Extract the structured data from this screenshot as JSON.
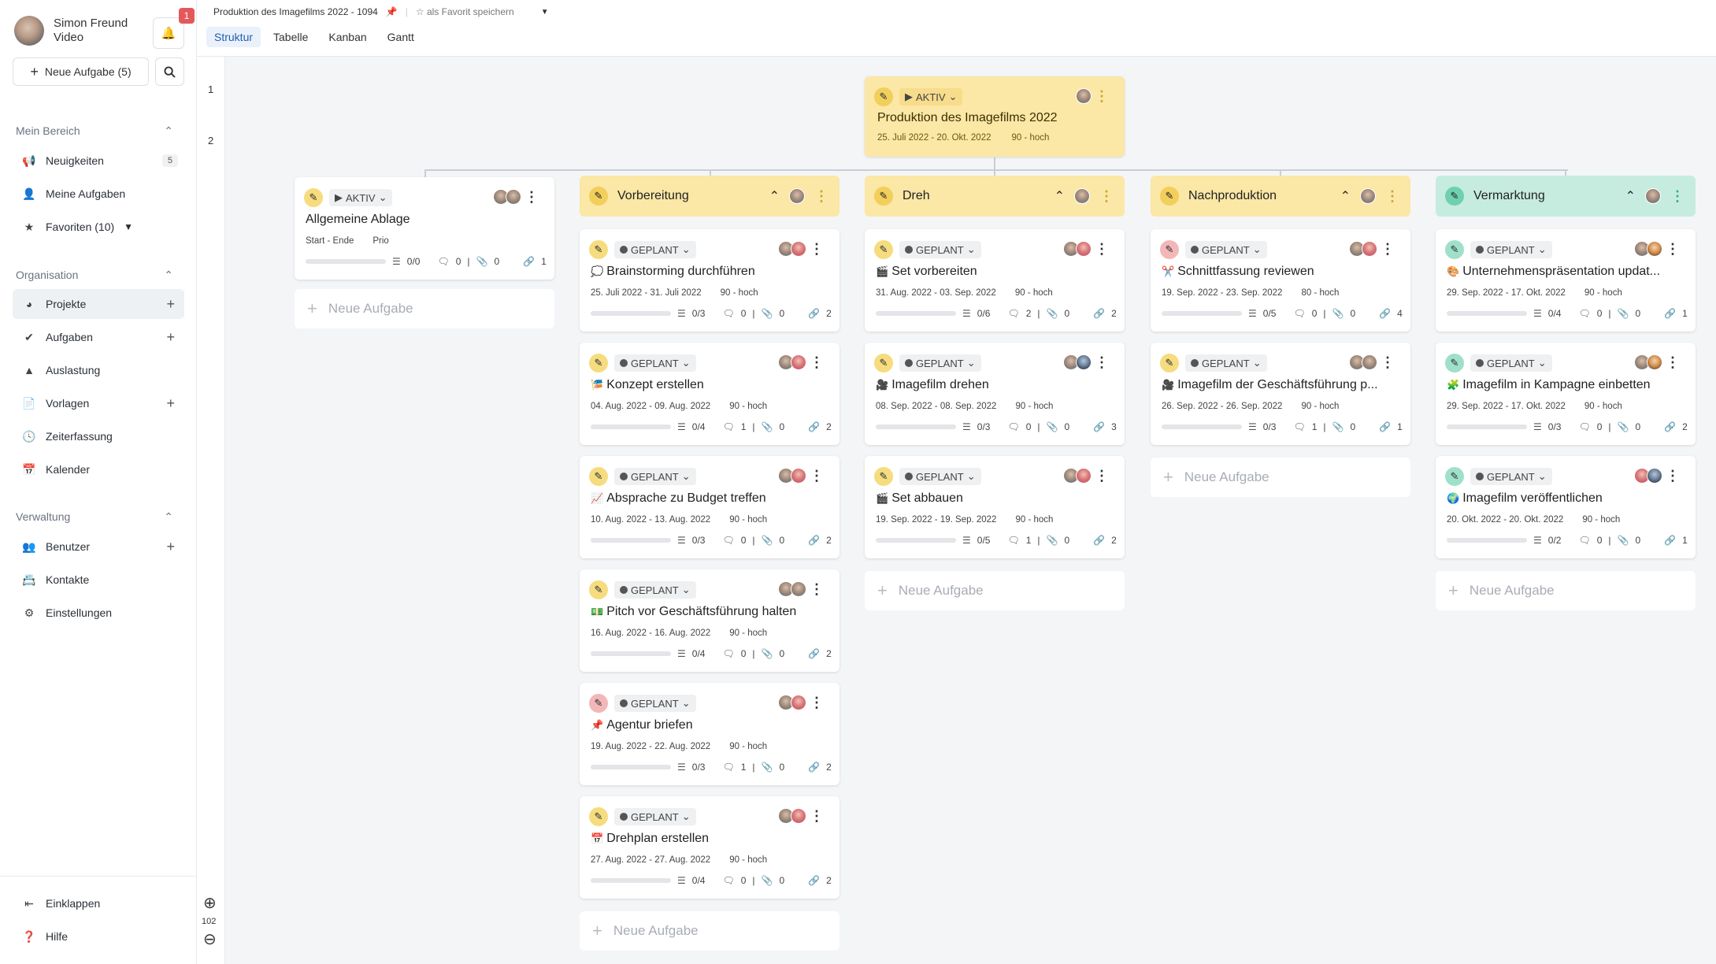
{
  "user": {
    "name": "Simon Freund",
    "role": "Video",
    "notifications": "1"
  },
  "sidebar": {
    "new_task_label": "Neue Aufgabe (5)",
    "mein_bereich": "Mein Bereich",
    "neuigkeiten": "Neuigkeiten",
    "neuigkeiten_count": "5",
    "meine_aufgaben": "Meine Aufgaben",
    "favoriten": "Favoriten (10)",
    "organisation": "Organisation",
    "projekte": "Projekte",
    "aufgaben": "Aufgaben",
    "auslastung": "Auslastung",
    "vorlagen": "Vorlagen",
    "zeiterfassung": "Zeiterfassung",
    "kalender": "Kalender",
    "verwaltung": "Verwaltung",
    "benutzer": "Benutzer",
    "kontakte": "Kontakte",
    "einstellungen": "Einstellungen",
    "einklappen": "Einklappen",
    "hilfe": "Hilfe"
  },
  "header": {
    "breadcrumb": "Produktion des Imagefilms 2022 - 1094",
    "favorite": "als Favorit speichern",
    "tabs": [
      "Struktur",
      "Tabelle",
      "Kanban",
      "Gantt"
    ]
  },
  "ruler": {
    "level1": "1",
    "level2": "2",
    "zoom": "102"
  },
  "root": {
    "status": "AKTIV",
    "title": "Produktion des Imagefilms 2022",
    "dates": "25. Juli 2022 - 20. Okt. 2022",
    "prio": "90 - hoch"
  },
  "ablage": {
    "status": "AKTIV",
    "title": "Allgemeine Ablage",
    "dates": "Start - Ende",
    "prio": "Prio",
    "checks": "0/0",
    "comments": "0",
    "attach": "0",
    "links": "1"
  },
  "new_task": "Neue Aufgabe",
  "columns": [
    {
      "title": "Vorbereitung",
      "tasks": [
        {
          "status": "GEPLANT",
          "emoji": "💭",
          "title": "Brainstorming durchführen",
          "dates": "25. Juli 2022 - 31. Juli 2022",
          "prio": "90 - hoch",
          "checks": "0/3",
          "comments": "0",
          "attach": "0",
          "links": "2"
        },
        {
          "status": "GEPLANT",
          "emoji": "🎏",
          "title": "Konzept erstellen",
          "dates": "04. Aug. 2022 - 09. Aug. 2022",
          "prio": "90 - hoch",
          "checks": "0/4",
          "comments": "1",
          "attach": "0",
          "links": "2"
        },
        {
          "status": "GEPLANT",
          "emoji": "📈",
          "title": "Absprache zu Budget treffen",
          "dates": "10. Aug. 2022 - 13. Aug. 2022",
          "prio": "90 - hoch",
          "checks": "0/3",
          "comments": "0",
          "attach": "0",
          "links": "2"
        },
        {
          "status": "GEPLANT",
          "emoji": "💵",
          "title": "Pitch vor Geschäftsführung halten",
          "dates": "16. Aug. 2022 - 16. Aug. 2022",
          "prio": "90 - hoch",
          "checks": "0/4",
          "comments": "0",
          "attach": "0",
          "links": "2"
        },
        {
          "status": "GEPLANT",
          "emoji": "📌",
          "title": "Agentur briefen",
          "dates": "19. Aug. 2022 - 22. Aug. 2022",
          "prio": "90 - hoch",
          "checks": "0/3",
          "comments": "1",
          "attach": "0",
          "links": "2"
        },
        {
          "status": "GEPLANT",
          "emoji": "📅",
          "title": "Drehplan erstellen",
          "dates": "27. Aug. 2022 - 27. Aug. 2022",
          "prio": "90 - hoch",
          "checks": "0/4",
          "comments": "0",
          "attach": "0",
          "links": "2"
        }
      ]
    },
    {
      "title": "Dreh",
      "tasks": [
        {
          "status": "GEPLANT",
          "emoji": "🎬",
          "title": "Set vorbereiten",
          "dates": "31. Aug. 2022 - 03. Sep. 2022",
          "prio": "90 - hoch",
          "checks": "0/6",
          "comments": "2",
          "attach": "0",
          "links": "2"
        },
        {
          "status": "GEPLANT",
          "emoji": "🎥",
          "title": "Imagefilm drehen",
          "dates": "08. Sep. 2022 - 08. Sep. 2022",
          "prio": "90 - hoch",
          "checks": "0/3",
          "comments": "0",
          "attach": "0",
          "links": "3"
        },
        {
          "status": "GEPLANT",
          "emoji": "🎬",
          "title": "Set abbauen",
          "dates": "19. Sep. 2022 - 19. Sep. 2022",
          "prio": "90 - hoch",
          "checks": "0/5",
          "comments": "1",
          "attach": "0",
          "links": "2"
        }
      ]
    },
    {
      "title": "Nachproduktion",
      "tasks": [
        {
          "status": "GEPLANT",
          "emoji": "✂️",
          "title": "Schnittfassung reviewen",
          "dates": "19. Sep. 2022 - 23. Sep. 2022",
          "prio": "80 - hoch",
          "checks": "0/5",
          "comments": "0",
          "attach": "0",
          "links": "4"
        },
        {
          "status": "GEPLANT",
          "emoji": "🎥",
          "title": "Imagefilm der Geschäftsführung p...",
          "dates": "26. Sep. 2022 - 26. Sep. 2022",
          "prio": "90 - hoch",
          "checks": "0/3",
          "comments": "1",
          "attach": "0",
          "links": "1"
        }
      ]
    },
    {
      "title": "Vermarktung",
      "tasks": [
        {
          "status": "GEPLANT",
          "emoji": "🎨",
          "title": "Unternehmenspräsentation updat...",
          "dates": "29. Sep. 2022 - 17. Okt. 2022",
          "prio": "90 - hoch",
          "checks": "0/4",
          "comments": "0",
          "attach": "0",
          "links": "1"
        },
        {
          "status": "GEPLANT",
          "emoji": "🧩",
          "title": "Imagefilm in Kampagne einbetten",
          "dates": "29. Sep. 2022 - 17. Okt. 2022",
          "prio": "90 - hoch",
          "checks": "0/3",
          "comments": "0",
          "attach": "0",
          "links": "2"
        },
        {
          "status": "GEPLANT",
          "emoji": "🌍",
          "title": "Imagefilm veröffentlichen",
          "dates": "20. Okt. 2022 - 20. Okt. 2022",
          "prio": "90 - hoch",
          "checks": "0/2",
          "comments": "0",
          "attach": "0",
          "links": "1"
        }
      ]
    }
  ]
}
